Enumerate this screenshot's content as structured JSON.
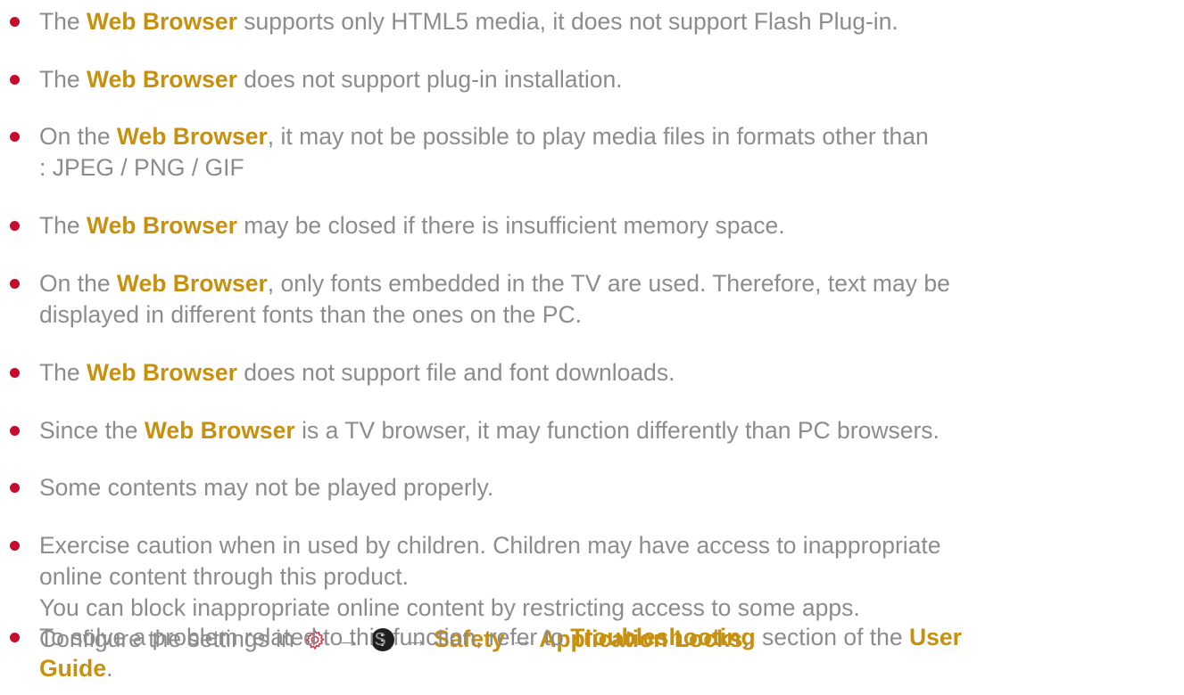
{
  "notes": [
    {
      "p1": "The ",
      "hl1": "Web Browser",
      "p2": " supports only HTML5 media, it does not support Flash Plug-in."
    },
    {
      "p1": "The ",
      "hl1": "Web Browser",
      "p2": " does not support plug-in installation."
    },
    {
      "p1": "On the ",
      "hl1": "Web Browser",
      "p2": ", it may not be possible to play media files in formats other than",
      "l2": ": JPEG / PNG / GIF"
    },
    {
      "p1": "The ",
      "hl1": "Web Browser",
      "p2": " may be closed if there is insufficient memory space."
    },
    {
      "p1": "On the ",
      "hl1": "Web Browser",
      "p2": ", only fonts embedded in the TV are used. Therefore, text may be",
      "l2": "displayed in different fonts than the ones on the PC."
    },
    {
      "p1": "The ",
      "hl1": "Web Browser",
      "p2": " does not support file and font downloads."
    },
    {
      "p1": "Since the ",
      "hl1": "Web Browser",
      "p2": " is a TV browser, it may function differently than PC browsers."
    },
    {
      "p1": "Some contents may not be played properly."
    },
    {
      "l1": "Exercise caution when in used by children. Children may have access to inappropriate",
      "l2": "online content through this product.",
      "l3": "You can block inappropriate online content by restricting access to some apps.",
      "l4_p1": "Configure the settings in ",
      "arrow": "→",
      "safety": "Safety",
      "locks": "Application Locks",
      "period": "."
    },
    {
      "p1": "To solve a problem related to this function, refer to ",
      "hl1": "Troubleshooting",
      "p2": " section of the ",
      "hl2": "User",
      "hl3": "Guide",
      "end": "."
    }
  ],
  "icons": {
    "settings": "gear-icon",
    "more": "more-options-icon"
  },
  "colors": {
    "text": "#8c8c8c",
    "highlight": "#c7900f",
    "bullet": "#c80a2d",
    "gear": "#d6344a"
  }
}
